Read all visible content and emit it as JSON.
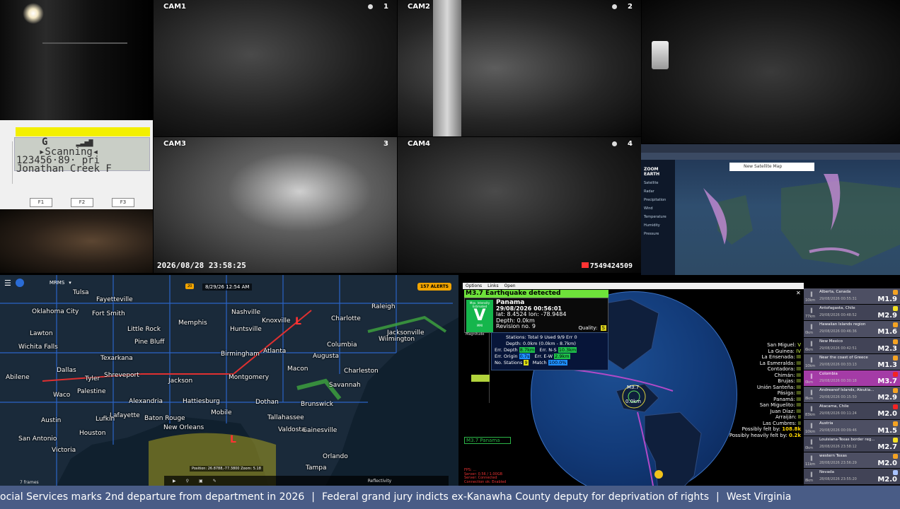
{
  "cameras": [
    {
      "label": "CAM1",
      "num": "1"
    },
    {
      "label": "CAM2",
      "num": "2"
    },
    {
      "label": "CAM3",
      "num": "3"
    },
    {
      "label": "CAM4",
      "num": "4"
    }
  ],
  "nvr": {
    "timestamp": "2026/08/28 23:58:25",
    "counter": "7549424509"
  },
  "scanner": {
    "line1": "G",
    "line2": "▸Scanning◂",
    "line3": "123456·89· pri",
    "line4": "Jonathan Creek F",
    "keys": [
      "F1",
      "F2",
      "F3"
    ]
  },
  "weather": {
    "logo": "ZOOM EARTH",
    "ad": "New Satellite Map",
    "menu": [
      "Satellite",
      "Radar",
      "Precipitation",
      "Wind",
      "Temperature",
      "Humidity",
      "Pressure"
    ]
  },
  "radar": {
    "product": "MRMS",
    "frame": "20",
    "time": "8/29/26 12:54 AM",
    "alerts": "157 ALERTS",
    "position": "Position: 26.8788,-77.3800  Zoom: 5.18",
    "frames": "7 frames",
    "layer": "Reflectivity",
    "cities": [
      "Tulsa",
      "Fayetteville",
      "Oklahoma City",
      "Fort Smith",
      "Memphis",
      "Nashville",
      "Knoxville",
      "Huntsville",
      "Charlotte",
      "Raleigh",
      "Wilmington",
      "Little Rock",
      "Lawton",
      "Pine Bluff",
      "Birmingham",
      "Atlanta",
      "Columbia",
      "Augusta",
      "Charleston",
      "Jacksonville",
      "Tallahassee",
      "Montgomery",
      "Jackson",
      "Shreveport",
      "Dallas",
      "Tyler",
      "Waco",
      "Austin",
      "Houston",
      "San Antonio",
      "Baton Rouge",
      "New Orleans",
      "Mobile",
      "Hattiesburg",
      "Savannah",
      "Macon",
      "Orlando",
      "Tampa",
      "Gainesville",
      "Victoria",
      "Wichita Falls",
      "Texarkana",
      "Alexandria",
      "Lafayette",
      "Lufkin",
      "Palestine",
      "Abilene",
      "Brunswick",
      "Valdosta",
      "Dothan"
    ]
  },
  "quake": {
    "menu": [
      "Options",
      "Links",
      "Open"
    ],
    "banner": "M3.7 Earthquake detected",
    "intensity": "V",
    "intensity_label": "Max. Intensity Estimated",
    "mmi": "MMI",
    "place": "Panama",
    "time": "29/08/2026 00:56:01",
    "coords": "lat: 8.4524 lon: -78.9484",
    "depth": "Depth: 0.0km",
    "revision": "Revision no. 9",
    "quality_label": "Quality:",
    "quality": "S",
    "magnitude_label": "Magnitude",
    "stations": "Stations: Total 9 Used 9/9 Err 0",
    "depth_range": "Depth: 0.0km (0.0km - 8.7km)",
    "err_depth": "Err. Depth",
    "err_depth_v": "8.7km",
    "err_ns": "Err. N-S",
    "err_ns_v": "10.3km",
    "err_origin": "Err. Origin",
    "err_origin_v": "0.7s",
    "err_ew": "Err. E-W",
    "err_ew_v": "2.9km",
    "no_stations": "No. Stations",
    "no_stations_v": "9",
    "match": "Match",
    "match_v": "100.0%",
    "marker_mag": "M3.7",
    "marker_depth": "0.0km",
    "tag": "M3.7 Panama",
    "places": [
      {
        "name": "San Miguel:",
        "v": "V"
      },
      {
        "name": "La Guinea:",
        "v": "IV"
      },
      {
        "name": "La Ensenada:",
        "v": "III"
      },
      {
        "name": "La Esmeralda:",
        "v": "III"
      },
      {
        "name": "Contadora:",
        "v": "III"
      },
      {
        "name": "Chimán:",
        "v": "III"
      },
      {
        "name": "Brujas:",
        "v": "III"
      },
      {
        "name": "Unión Santeña:",
        "v": "III"
      },
      {
        "name": "Pásiga:",
        "v": "III"
      },
      {
        "name": "Panamá:",
        "v": "III"
      },
      {
        "name": "San Miguelito:",
        "v": "III"
      },
      {
        "name": "Juan Díaz:",
        "v": "III"
      },
      {
        "name": "Arraiján:",
        "v": "II"
      },
      {
        "name": "Las Cumbres:",
        "v": "II"
      }
    ],
    "felt_by": "Possibly felt by:",
    "felt_by_v": "108.8k",
    "heavily_felt_by": "Possibly heavily felt by:",
    "heavily_felt_by_v": "0.2k",
    "status_lines": [
      "FPS: ...",
      "Server: 0.56 / 1.00GB",
      "Server: Connected",
      "Connection ok: Enabled"
    ]
  },
  "events": [
    {
      "place": "Alberta, Canada",
      "time": "29/08/2026 00:55:31",
      "mag": "M1.9",
      "dist": "10km",
      "color": "#f4a323"
    },
    {
      "place": "Antofagasta, Chile",
      "time": "29/08/2026 00:48:52",
      "mag": "M2.9",
      "dist": "77km",
      "color": "#f4e023"
    },
    {
      "place": "Hawaiian Islands region",
      "time": "29/08/2026 00:46:36",
      "mag": "M1.6",
      "dist": "0km",
      "color": "#f4a323"
    },
    {
      "place": "New Mexico",
      "time": "29/08/2026 00:42:51",
      "mag": "M2.3",
      "dist": "6km",
      "color": "#f4a323"
    },
    {
      "place": "Near the coast of Greece",
      "time": "29/08/2026 00:33:13",
      "mag": "M1.3",
      "dist": "10km",
      "color": "#f4a323"
    },
    {
      "place": "Colombia",
      "time": "29/08/2026 00:30:18",
      "mag": "M3.7",
      "dist": "0km",
      "color": "#f42323"
    },
    {
      "place": "Andreanof Islands, Aleutia...",
      "time": "29/08/2026 00:15:50",
      "mag": "M2.9",
      "dist": "8km",
      "color": "#f4a323"
    },
    {
      "place": "Atacama, Chile",
      "time": "29/08/2026 00:11:24",
      "mag": "M2.0",
      "dist": "83km",
      "color": "#f42323"
    },
    {
      "place": "Austria",
      "time": "29/08/2026 00:09:46",
      "mag": "M1.5",
      "dist": "10km",
      "color": "#f4a323"
    },
    {
      "place": "Louisiana-Texas border reg...",
      "time": "28/08/2026 23:58:12",
      "mag": "M2.7",
      "dist": "0km",
      "color": "#f4e023"
    },
    {
      "place": "western Texas",
      "time": "28/08/2026 23:56:29",
      "mag": "M2.0",
      "dist": "11km",
      "color": "#f4a323"
    },
    {
      "place": "Nevada",
      "time": "28/08/2026 23:55:20",
      "mag": "M2.0",
      "dist": "8km",
      "color": "#aac4ff"
    }
  ],
  "ticker": [
    "ocial Services marks 2nd departure from department in 2026",
    "Federal grand jury indicts ex-Kanawha County deputy for deprivation of rights",
    "West Virginia"
  ]
}
